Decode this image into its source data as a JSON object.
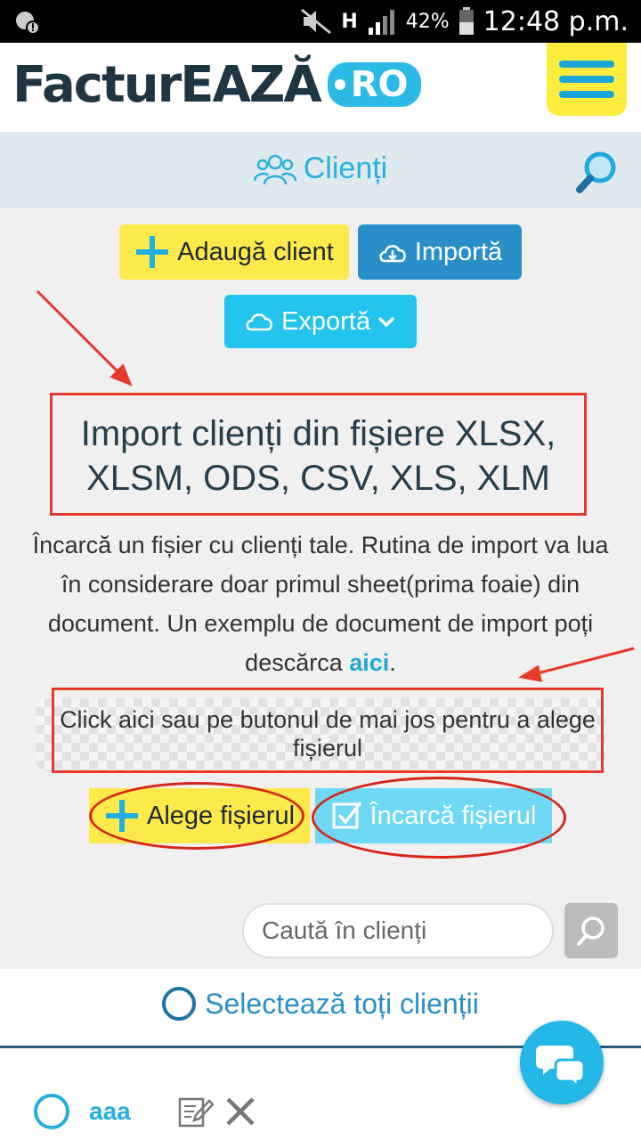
{
  "status_bar": {
    "battery_percent": "42%",
    "time": "12:48 p.m.",
    "signal": "H"
  },
  "header": {
    "logo_text": "FacturEAZĂ",
    "logo_suffix": "RO"
  },
  "title_bar": {
    "title": "Clienți"
  },
  "actions": {
    "add_client": "Adaugă client",
    "import": "Importă",
    "export": "Exportă"
  },
  "import_section": {
    "heading": "Import clienți din fișiere XLSX, XLSM, ODS, CSV, XLS, XLM",
    "description": "Încarcă un fișier cu clienți tale. Rutina de import va lua în considerare doar primul sheet(prima foaie) din document. Un exemplu de document de import poți descărca",
    "link_text": "aici",
    "link_suffix": ".",
    "dropzone_text": "Click aici sau pe butonul de mai jos pentru a alege fișierul",
    "choose_file": "Alege fișierul",
    "upload_file": "Încarcă fișierul"
  },
  "search": {
    "placeholder": "Caută în clienți"
  },
  "list": {
    "select_all": "Selectează toți clienții",
    "rows": [
      {
        "name": "aaa"
      }
    ]
  },
  "colors": {
    "accent": "#22c3ec",
    "brand_yellow": "#fce94a",
    "annotation_red": "#e53a2b"
  }
}
